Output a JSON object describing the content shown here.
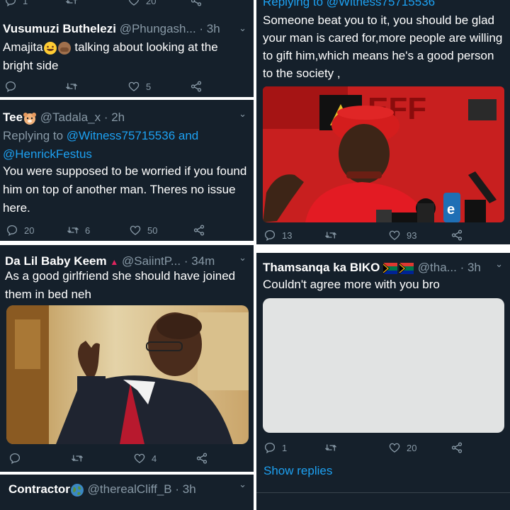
{
  "p1": {
    "counts": {
      "reply": "1",
      "like": "20"
    },
    "name": "Vusumuzi Buthelezi",
    "handle": "@Phungash...",
    "time": "· 3h",
    "text_a": "Amajita",
    "text_b": "talking about looking at the bright side",
    "actions": {
      "reply": "",
      "retweet": "",
      "like": "5"
    }
  },
  "p2": {
    "name": "Tee",
    "handle": "@Tadala_x",
    "time": "· 2h",
    "replying_prefix": "Replying to",
    "mention_1": "@Witness75715536",
    "and": "and",
    "mention_2": "@HenrickFestus",
    "text": "You were supposed to be worried if you found him on top of another man. Theres no issue here.",
    "actions": {
      "reply": "20",
      "retweet": "6",
      "like": "50"
    }
  },
  "p3": {
    "name": "Da Lil Baby Keem",
    "handle": "@SaiintP...",
    "time": "· 34m",
    "text": "As a good girlfriend she should have joined them in  bed neh",
    "actions": {
      "reply": "",
      "retweet": "",
      "like": "4"
    }
  },
  "p4": {
    "name": "Contractor",
    "handle": "@therealCliff_B",
    "time": "· 3h"
  },
  "p5": {
    "replying_partial": "Replying to @Witness75715536",
    "text": "Someone beat you to it, you should be glad your man is cared for,more people are willing to gift him,which means he's a good person to the society ,",
    "image_text": "EFF",
    "actions": {
      "reply": "13",
      "retweet": "",
      "like": "93"
    }
  },
  "p6": {
    "name": "Thamsanqa ka BIKO",
    "handle": "@tha...",
    "time": "· 3h",
    "text": "Couldn't agree more with you bro",
    "actions": {
      "reply": "1",
      "retweet": "",
      "like": "20"
    },
    "show_replies": "Show replies"
  },
  "colors": {
    "bg": "#15202b",
    "text": "#ffffff",
    "muted": "#8899a6",
    "link": "#1da1f2"
  }
}
